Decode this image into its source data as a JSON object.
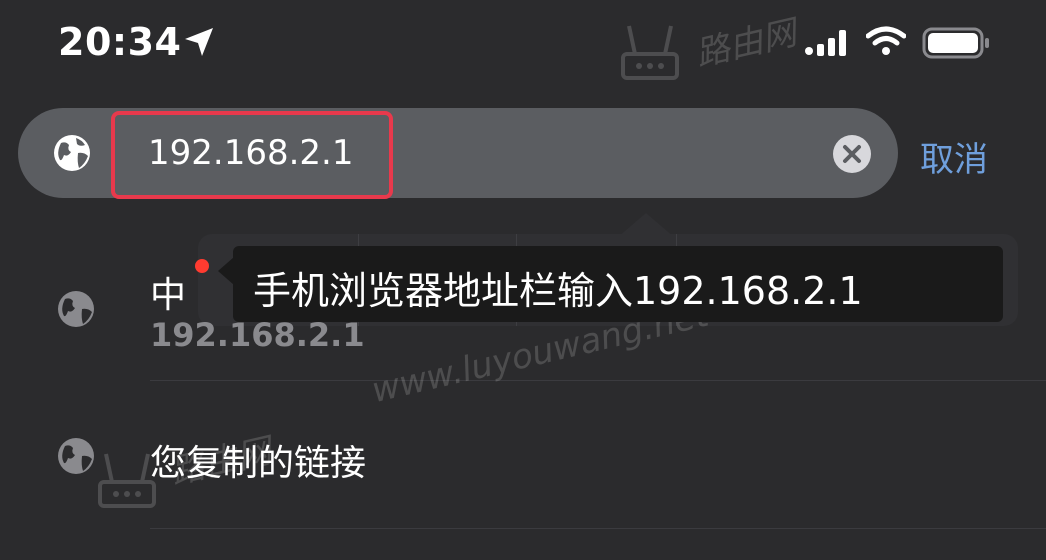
{
  "status_bar": {
    "time": "20:34",
    "icons": [
      "location-arrow-icon",
      "cellular-signal-icon",
      "wifi-icon",
      "battery-icon"
    ]
  },
  "address_bar": {
    "url": "192.168.2.1",
    "leading_icon": "globe-icon",
    "trailing_icon": "clear-icon",
    "highlight_color": "#e8394c"
  },
  "cancel_label": "取消",
  "tooltip": {
    "text": "手机浏览器地址栏输入192.168.2.1"
  },
  "suggestions": [
    {
      "icon": "globe-icon",
      "title": "中",
      "subtitle": "192.168.2.1"
    },
    {
      "icon": "globe-icon",
      "title": "您复制的链接"
    }
  ],
  "watermark": {
    "url": "www.luyouwang.net",
    "brand": "路由网"
  },
  "colors": {
    "background": "#2b2b2d",
    "address_bar": "#5b5d61",
    "accent_link": "#6f9fdc",
    "notification_dot": "#ff3b30"
  }
}
